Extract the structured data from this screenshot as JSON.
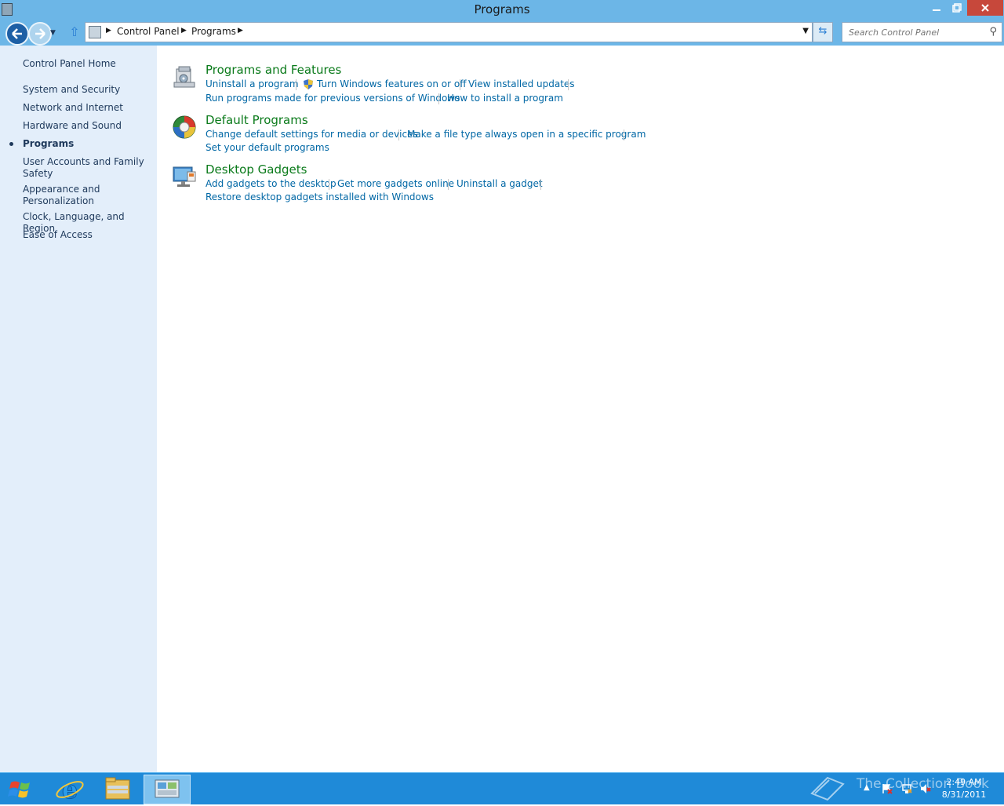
{
  "window": {
    "title": "Programs",
    "controls": {
      "minimize_icon": "minimize-icon",
      "maximize_icon": "restore-icon",
      "close_icon": "close-icon"
    }
  },
  "navigation": {
    "breadcrumb": [
      "Control Panel",
      "Programs"
    ],
    "search_placeholder": "Search Control Panel",
    "icons": [
      "back-icon",
      "forward-icon",
      "up-icon",
      "refresh-icon",
      "search-icon"
    ]
  },
  "sidebar": {
    "items": [
      {
        "label": "Control Panel Home",
        "current": false
      },
      {
        "label": "System and Security",
        "current": false
      },
      {
        "label": "Network and Internet",
        "current": false
      },
      {
        "label": "Hardware and Sound",
        "current": false
      },
      {
        "label": "Programs",
        "current": true
      },
      {
        "label": "User Accounts and Family Safety",
        "current": false
      },
      {
        "label": "Appearance and Personalization",
        "current": false
      },
      {
        "label": "Clock, Language, and Region",
        "current": false
      },
      {
        "label": "Ease of Access",
        "current": false
      }
    ]
  },
  "sections": [
    {
      "title": "Programs and Features",
      "icon": "programs-features-icon",
      "links": [
        "Uninstall a program",
        "Turn Windows features on or off",
        "View installed updates",
        "Run programs made for previous versions of Windows",
        "How to install a program"
      ]
    },
    {
      "title": "Default Programs",
      "icon": "default-programs-icon",
      "links": [
        "Change default settings for media or devices",
        "Make a file type always open in a specific program",
        "Set your default programs"
      ]
    },
    {
      "title": "Desktop Gadgets",
      "icon": "desktop-gadgets-icon",
      "links": [
        "Add gadgets to the desktop",
        "Get more gadgets online",
        "Uninstall a gadget",
        "Restore desktop gadgets installed with Windows"
      ]
    }
  ],
  "taskbar": {
    "pinned": [
      "start-icon",
      "internet-explorer-icon",
      "file-explorer-icon",
      "control-panel-icon"
    ],
    "watermark": "The Collection Book",
    "time": "2:49 AM",
    "date": "8/31/2011"
  },
  "colors": {
    "frame": "#6cb6e7",
    "sidebar": "#e3eefa",
    "section_title": "#0a7a1a",
    "link": "#0067a5",
    "taskbar": "#1f8ad8"
  }
}
